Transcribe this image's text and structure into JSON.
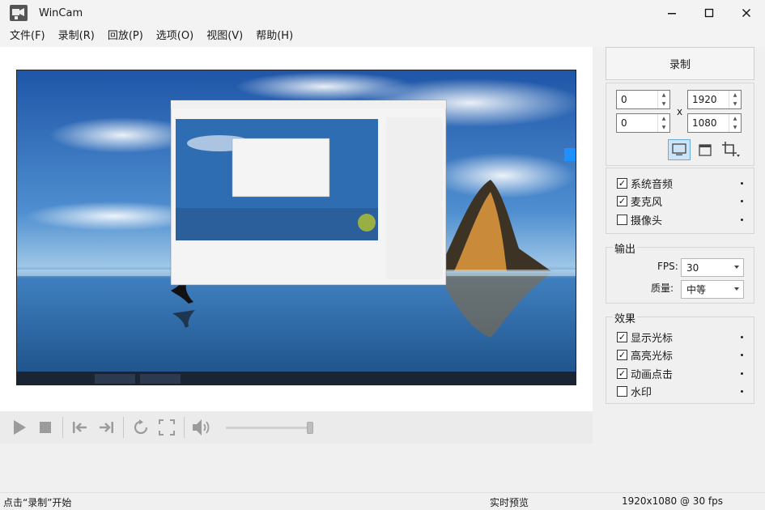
{
  "window": {
    "title": "WinCam",
    "minimize_glyph": "—",
    "maximize_glyph": "☐",
    "close_glyph": "✕"
  },
  "menu": [
    "文件(F)",
    "录制(R)",
    "回放(P)",
    "选项(O)",
    "视图(V)",
    "帮助(H)"
  ],
  "record_button": "录制",
  "region": {
    "x": "0",
    "y": "0",
    "width": "1920",
    "height": "1080",
    "separator": "x"
  },
  "source_icons": [
    "monitor-icon",
    "window-icon",
    "crop-icon"
  ],
  "audio": [
    {
      "label": "系统音频",
      "checked": true
    },
    {
      "label": "麦克风",
      "checked": true
    },
    {
      "label": "摄像头",
      "checked": false
    }
  ],
  "output": {
    "title": "输出",
    "fps_label": "FPS:",
    "fps_value": "30",
    "quality_label": "质量:",
    "quality_value": "中等"
  },
  "effects": {
    "title": "效果",
    "items": [
      {
        "label": "显示光标",
        "checked": true
      },
      {
        "label": "高亮光标",
        "checked": true
      },
      {
        "label": "动画点击",
        "checked": true
      },
      {
        "label": "水印",
        "checked": false
      }
    ]
  },
  "playback_icons": [
    "play-icon",
    "stop-icon",
    "skip-start-icon",
    "skip-end-icon",
    "loop-icon",
    "fullscreen-icon",
    "volume-icon"
  ],
  "volume_level": 1.0,
  "status": {
    "left": "点击“录制”开始",
    "middle": "实时预览",
    "right": "1920x1080 @ 30 fps"
  },
  "colors": {
    "accent": "#0078d4",
    "selected_bg": "#cce4f7"
  }
}
